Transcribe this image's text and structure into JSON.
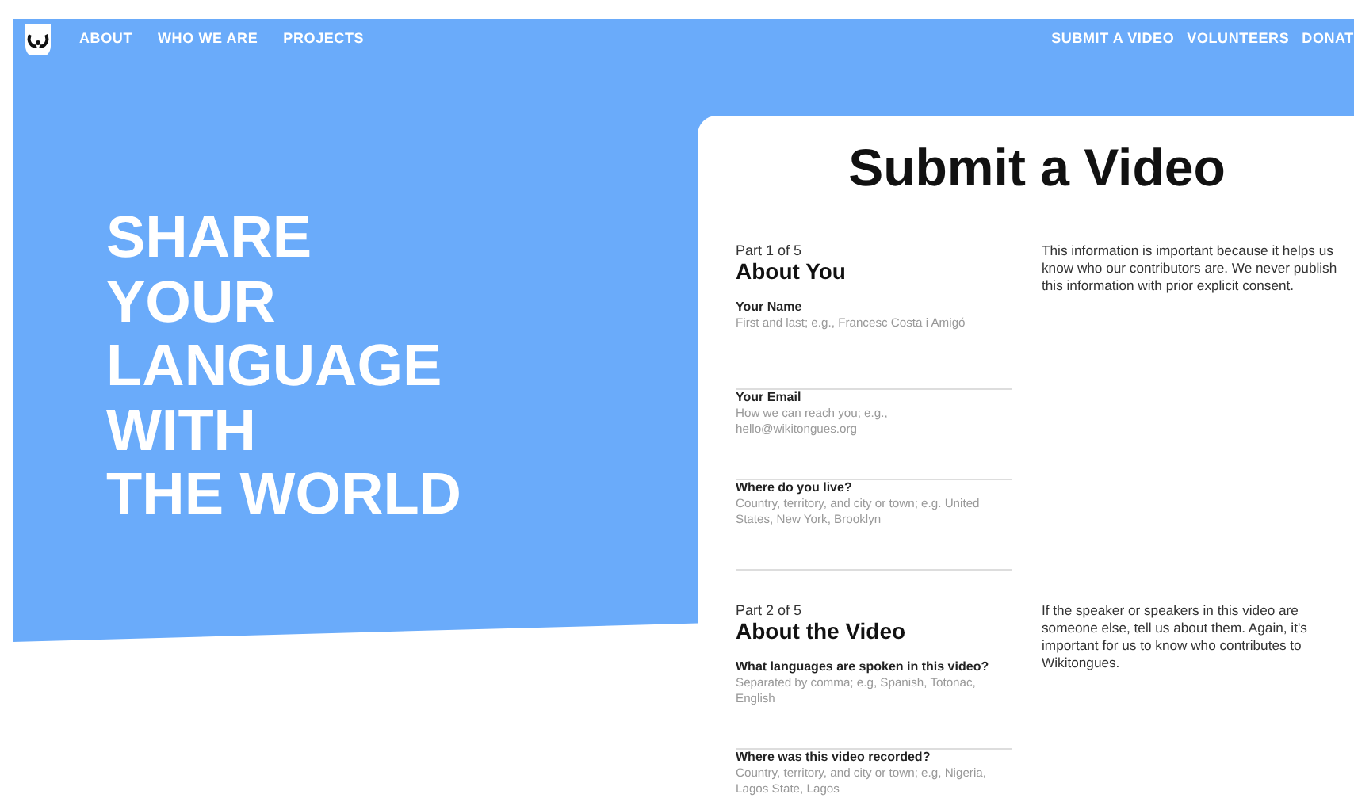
{
  "nav": {
    "left_links": [
      "ABOUT",
      "WHO WE ARE",
      "PROJECTS"
    ],
    "right_links": [
      "SUBMIT A VIDEO",
      "VOLUNTEERS",
      "DONAT"
    ]
  },
  "hero": {
    "headline_lines": [
      "SHARE",
      "YOUR",
      "LANGUAGE",
      "WITH",
      "THE WORLD"
    ]
  },
  "form": {
    "title": "Submit a Video",
    "sections": [
      {
        "part": "Part 1 of 5",
        "heading": "About You",
        "note": "This information is important because it helps us know who our contributors are. We never publish this information with prior explicit consent.",
        "fields": [
          {
            "label": "Your Name",
            "placeholder": "First and last; e.g., Francesc Costa i Amigó"
          },
          {
            "label": "Your Email",
            "placeholder": "How we can reach you; e.g., hello@wikitongues.org"
          },
          {
            "label": "Where do you live?",
            "placeholder": "Country, territory, and city or town; e.g. United States, New York, Brooklyn"
          }
        ]
      },
      {
        "part": "Part 2 of 5",
        "heading": "About the Video",
        "note": "If the speaker or speakers in this video are someone else, tell us about them. Again, it's important for us to know who contributes to Wikitongues.",
        "fields": [
          {
            "label": "What languages are spoken in this video?",
            "placeholder": "Separated by comma; e.g, Spanish, Totonac, English"
          },
          {
            "label": "Where was this video recorded?",
            "placeholder": "Country, territory, and city or town; e.g, Nigeria, Lagos State, Lagos"
          }
        ]
      }
    ]
  }
}
